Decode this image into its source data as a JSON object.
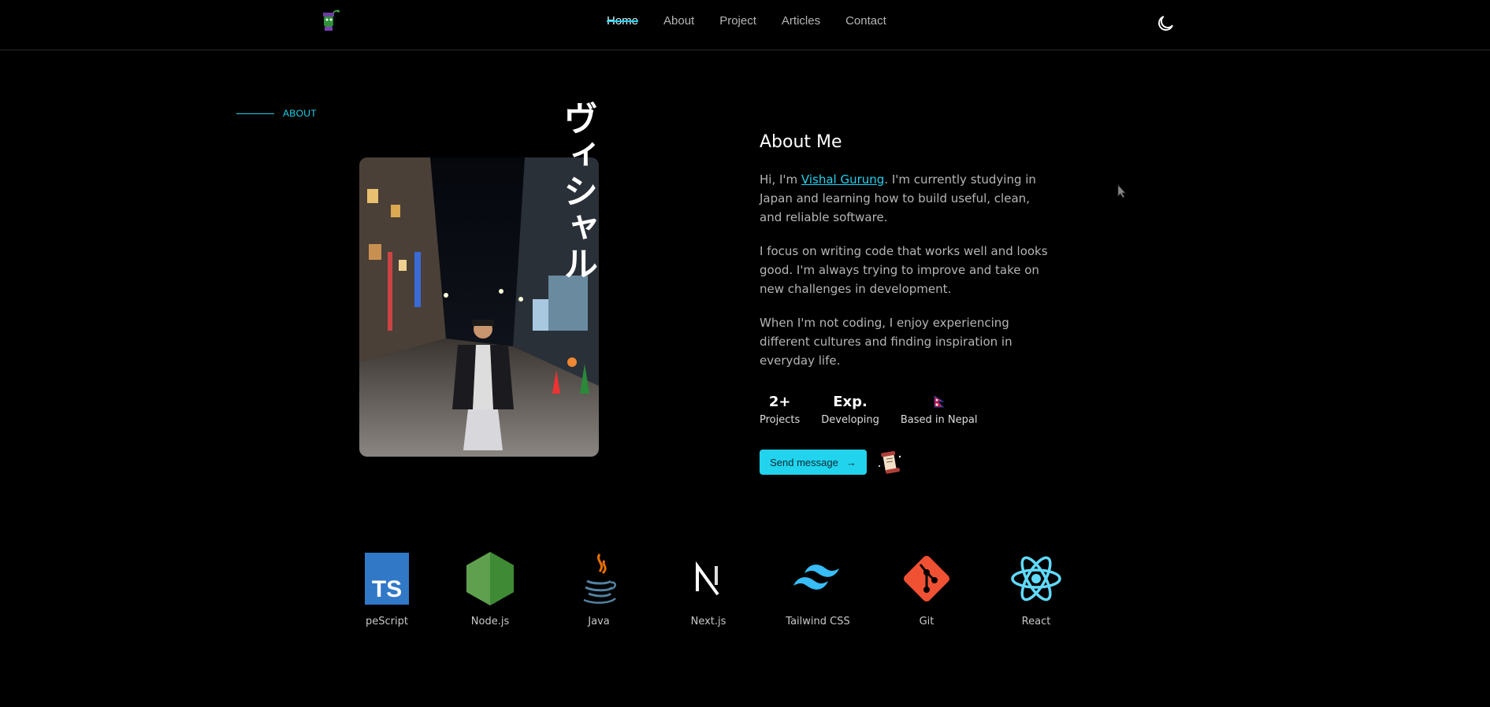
{
  "nav": {
    "links": [
      {
        "label": "Home",
        "active": true
      },
      {
        "label": "About"
      },
      {
        "label": "Project"
      },
      {
        "label": "Articles"
      },
      {
        "label": "Contact"
      }
    ],
    "theme_icon": "moon-icon"
  },
  "section": {
    "label": "ABOUT"
  },
  "vertical_text": "ヴィシャル",
  "about": {
    "title": "About Me",
    "intro_prefix": "Hi, I'm ",
    "name_link": "Vishal Gurung",
    "intro_suffix": ". I'm currently studying in Japan and learning how to build useful, clean, and reliable software.",
    "p2": "I focus on writing code that works well and looks good. I'm always trying to improve and take on new challenges in development.",
    "p3": "When I'm not coding, I enjoy experiencing different cultures and finding inspiration in everyday life."
  },
  "stats": [
    {
      "value": "2+",
      "label": "Projects"
    },
    {
      "value": "Exp.",
      "label": "Developing"
    },
    {
      "value_icon": "nepal-flag-icon",
      "label": "Based in Nepal"
    }
  ],
  "cta": {
    "label": "Send message",
    "arrow": "→"
  },
  "tech": [
    {
      "label": "peScript",
      "icon": "typescript-icon"
    },
    {
      "label": "Node.js",
      "icon": "nodejs-icon"
    },
    {
      "label": "Java",
      "icon": "java-icon"
    },
    {
      "label": "Next.js",
      "icon": "nextjs-icon"
    },
    {
      "label": "Tailwind CSS",
      "icon": "tailwind-icon"
    },
    {
      "label": "Git",
      "icon": "git-icon"
    },
    {
      "label": "React",
      "icon": "react-icon"
    }
  ],
  "colors": {
    "accent": "#22d3ee",
    "background": "#000000",
    "text_muted": "#b5b5b5"
  }
}
